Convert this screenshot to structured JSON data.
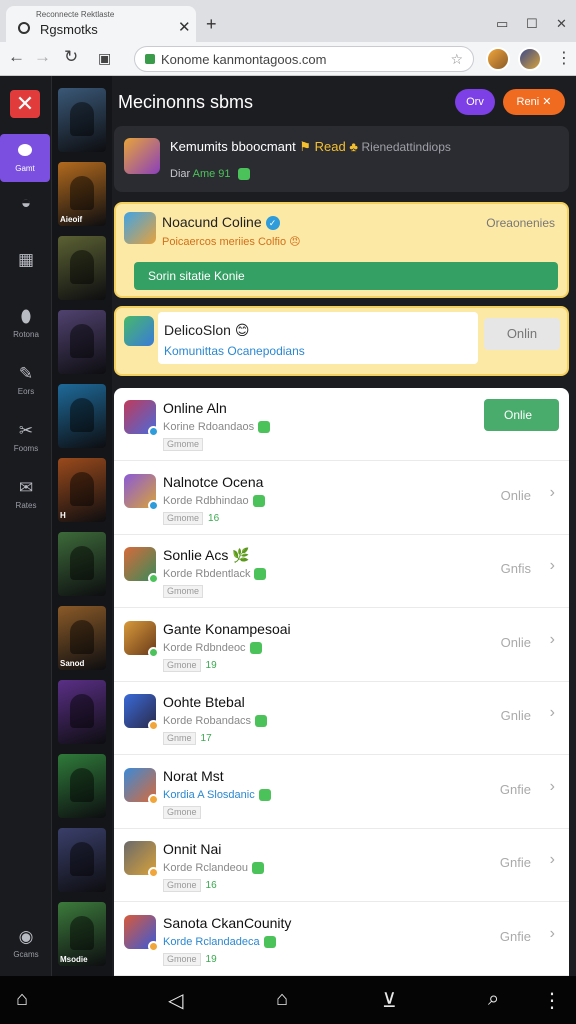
{
  "browser": {
    "tab_subtitle": "Reconnecte Rektlaste",
    "tab_title": "Rgsmotks",
    "url": "Konome kanmontagoos.com",
    "window_controls": [
      "restore-icon",
      "maximize-icon",
      "close-icon"
    ]
  },
  "rail": {
    "logo_glyph": "✕",
    "active_label": "Gamt",
    "items": [
      {
        "icon": "globe-icon",
        "glyph": "◒",
        "label": ""
      },
      {
        "icon": "grid-icon",
        "glyph": "▦",
        "label": ""
      },
      {
        "icon": "bottle-icon",
        "glyph": "⬮",
        "label": "Rotona"
      },
      {
        "icon": "pencil-icon",
        "glyph": "✎",
        "label": "Eors"
      },
      {
        "icon": "tools-icon",
        "glyph": "✂",
        "label": "Fooms"
      },
      {
        "icon": "chat-icon",
        "glyph": "✉",
        "label": "Rates"
      }
    ],
    "bottom_label": "Gcams"
  },
  "thumbnails": [
    {
      "color": "#3a5877",
      "caption": ""
    },
    {
      "color": "#b26a1e",
      "caption": "Aieoif"
    },
    {
      "color": "#5b6133",
      "caption": ""
    },
    {
      "color": "#50426f",
      "caption": ""
    },
    {
      "color": "#1e6a9a",
      "caption": ""
    },
    {
      "color": "#9a4a1c",
      "caption": "H"
    },
    {
      "color": "#3d6a3a",
      "caption": ""
    },
    {
      "color": "#8a5a28",
      "caption": "Sanod"
    },
    {
      "color": "#5a2f86",
      "caption": ""
    },
    {
      "color": "#2f7a3a",
      "caption": ""
    },
    {
      "color": "#3a3f6a",
      "caption": ""
    },
    {
      "color": "#3c7a3c",
      "caption": "Msodie"
    }
  ],
  "header": {
    "title": "Mecinonns sbms",
    "button_primary": "Orv",
    "button_secondary": "Reni ✕"
  },
  "featured": {
    "title": "Kemumits bboocmant",
    "tag": "⚑ Read ♣",
    "subtitle": "Rienedattindiops",
    "meta_prefix": "Diar",
    "meta_value": "Ame 91"
  },
  "highlight": {
    "title": "Noacund Coline",
    "subtitle": "Poicaercos meriies Colfio 😠",
    "right_label": "Oreaonenies",
    "bar_label": "Sorin sitatie Konie"
  },
  "promo": {
    "title": "DelicoSlon 😊",
    "subtitle": "Komunittas Ocanepodians",
    "button": "Onlin"
  },
  "games": [
    {
      "title": "Online Aln",
      "line2": "Korine Rdoandaos",
      "chip": "Gmome",
      "count": "",
      "status": "Onlie",
      "blue": false,
      "colors": [
        "#c03a5a",
        "#4a6bd8"
      ],
      "badge": "#2e9cdb",
      "button": true
    },
    {
      "title": "Nalnotce Ocena",
      "line2": "Korde Rdbhindao",
      "chip": "Gmome",
      "count": "16",
      "status": "Onlie",
      "blue": false,
      "colors": [
        "#8a5ad8",
        "#d8a23a"
      ],
      "badge": "#2e9cdb",
      "button": false
    },
    {
      "title": "Sonlie Acs 🌿",
      "line2": "Korde Rbdentlack",
      "chip": "Gmome",
      "count": "",
      "status": "Gnfis",
      "blue": false,
      "colors": [
        "#d86a3a",
        "#3a8a5a"
      ],
      "badge": "#4cc35a",
      "button": false
    },
    {
      "title": "Gante Konampesoai",
      "line2": "Korde Rdbndeoc",
      "chip": "Gmone",
      "count": "19",
      "status": "Onlie",
      "blue": false,
      "colors": [
        "#d89a3a",
        "#6a3a1a"
      ],
      "badge": "#4cc35a",
      "button": false
    },
    {
      "title": "Oohte Btebal",
      "line2": "Korde Robandacs",
      "chip": "Gnme",
      "count": "17",
      "status": "Gnlie",
      "blue": false,
      "colors": [
        "#3a6ad8",
        "#2a2a4a"
      ],
      "badge": "#f0a63a",
      "button": false
    },
    {
      "title": "Norat Mst",
      "line2": "Kordia A Slosdanic",
      "chip": "Gmone",
      "count": "",
      "status": "Gnfie",
      "blue": true,
      "colors": [
        "#3a8ad8",
        "#d86a3a"
      ],
      "badge": "#f0a63a",
      "button": false
    },
    {
      "title": "Onnit Nai",
      "line2": "Korde Rclandeou",
      "chip": "Gmone",
      "count": "16",
      "status": "Gnfie",
      "blue": false,
      "colors": [
        "#6a6a6a",
        "#d8a23a"
      ],
      "badge": "#f0a63a",
      "button": false
    },
    {
      "title": "Sanota CkanCounity",
      "line2": "Korde Rclandadeca",
      "chip": "Gmone",
      "count": "19",
      "status": "Gnfie",
      "blue": true,
      "colors": [
        "#d85a3a",
        "#3a5ad8"
      ],
      "badge": "#f0a63a",
      "button": false
    }
  ],
  "bottom_nav": [
    "home-icon",
    "back-icon",
    "house-outline-icon",
    "download-icon",
    "search-icon",
    "menu-icon"
  ]
}
